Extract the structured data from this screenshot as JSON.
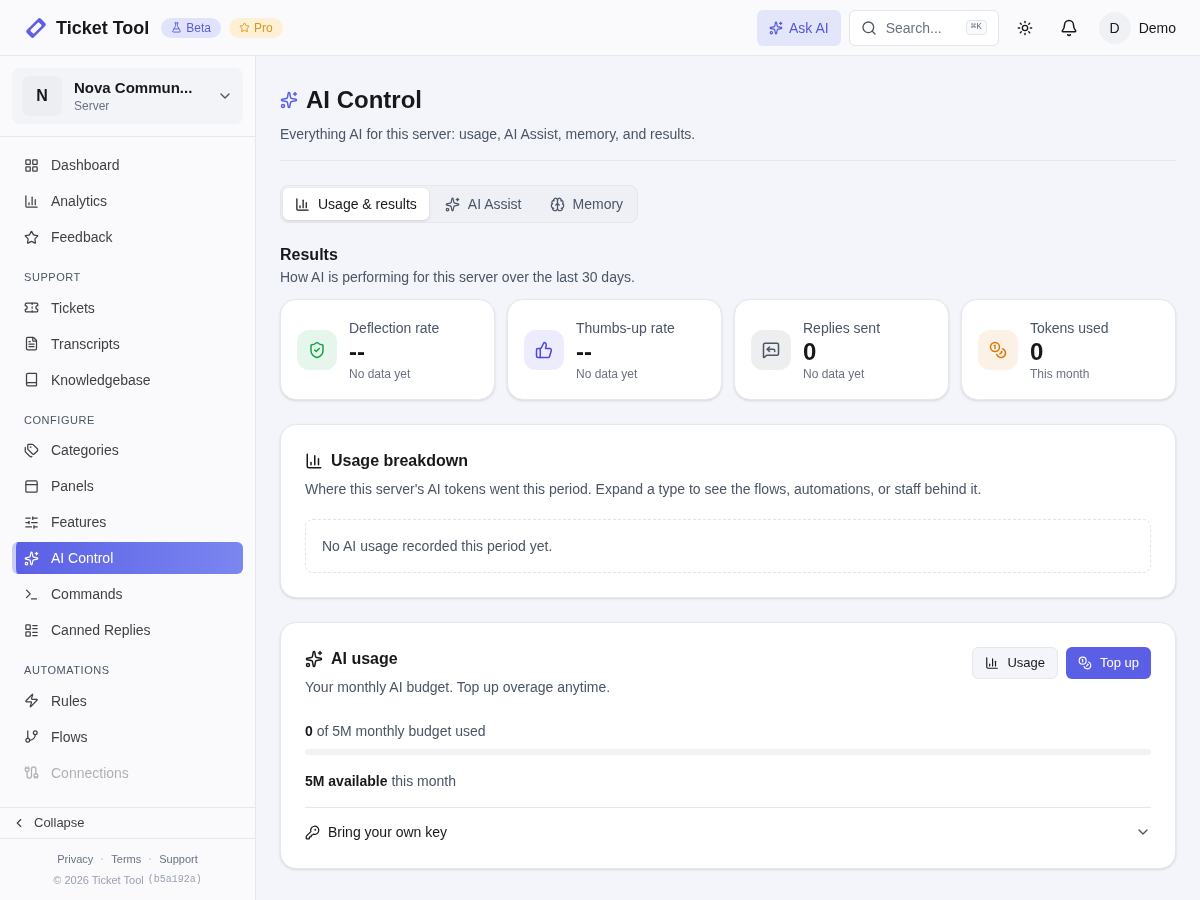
{
  "header": {
    "brand": "Ticket Tool",
    "badges": [
      {
        "label": "Beta",
        "kind": "beta"
      },
      {
        "label": "Pro",
        "kind": "pro"
      }
    ],
    "ask_ai": "Ask AI",
    "search": {
      "placeholder": "Search...",
      "shortcut": "⌘K"
    },
    "user": {
      "initial": "D",
      "name": "Demo"
    }
  },
  "server": {
    "initial": "N",
    "name": "Nova Commun...",
    "role": "Server"
  },
  "sidebar": {
    "sections": [
      {
        "items": [
          {
            "label": "Dashboard",
            "selected": false
          },
          {
            "label": "Analytics",
            "selected": false
          },
          {
            "label": "Feedback",
            "selected": false
          }
        ]
      },
      {
        "title": "SUPPORT",
        "items": [
          {
            "label": "Tickets",
            "selected": false
          },
          {
            "label": "Transcripts",
            "selected": false
          },
          {
            "label": "Knowledgebase",
            "selected": false
          }
        ]
      },
      {
        "title": "CONFIGURE",
        "items": [
          {
            "label": "Categories",
            "selected": false
          },
          {
            "label": "Panels",
            "selected": false
          },
          {
            "label": "Features",
            "selected": false
          },
          {
            "label": "AI Control",
            "selected": true
          },
          {
            "label": "Commands",
            "selected": false
          },
          {
            "label": "Canned Replies",
            "selected": false
          }
        ]
      },
      {
        "title": "AUTOMATIONS",
        "items": [
          {
            "label": "Rules",
            "selected": false
          },
          {
            "label": "Flows",
            "selected": false
          },
          {
            "label": "Connections",
            "selected": false
          }
        ]
      }
    ],
    "collapse": "Collapse",
    "footer_links": [
      "Privacy",
      "Terms",
      "Support"
    ],
    "copyright": "© 2026 Ticket Tool",
    "build": "(b5a192a)"
  },
  "page": {
    "title": "AI Control",
    "subtitle": "Everything AI for this server: usage, AI Assist, memory, and results.",
    "tabs": [
      {
        "label": "Usage & results",
        "selected": true
      },
      {
        "label": "AI Assist",
        "selected": false
      },
      {
        "label": "Memory",
        "selected": false
      }
    ],
    "results": {
      "title": "Results",
      "subtitle": "How AI is performing for this server over the last 30 days.",
      "cards": [
        {
          "label": "Deflection rate",
          "value": "--",
          "note": "No data yet",
          "color": "#16a34a"
        },
        {
          "label": "Thumbs-up rate",
          "value": "--",
          "note": "No data yet",
          "color": "#4f46e5"
        },
        {
          "label": "Replies sent",
          "value": "0",
          "note": "No data yet",
          "color": "#4b5563"
        },
        {
          "label": "Tokens used",
          "value": "0",
          "note": "This month",
          "color": "#d97706"
        }
      ]
    },
    "breakdown": {
      "title": "Usage breakdown",
      "subtitle": "Where this server's AI tokens went this period. Expand a type to see the flows, automations, or staff behind it.",
      "empty": "No AI usage recorded this period yet."
    },
    "usage": {
      "title": "AI usage",
      "subtitle": "Your monthly AI budget. Top up overage anytime.",
      "buttons": [
        "Usage",
        "Top up"
      ],
      "used_line": "**0** of 5M monthly budget used",
      "available_line": "**5M available** this month",
      "byok": {
        "label": "Bring your own key",
        "expanded": false
      }
    }
  }
}
